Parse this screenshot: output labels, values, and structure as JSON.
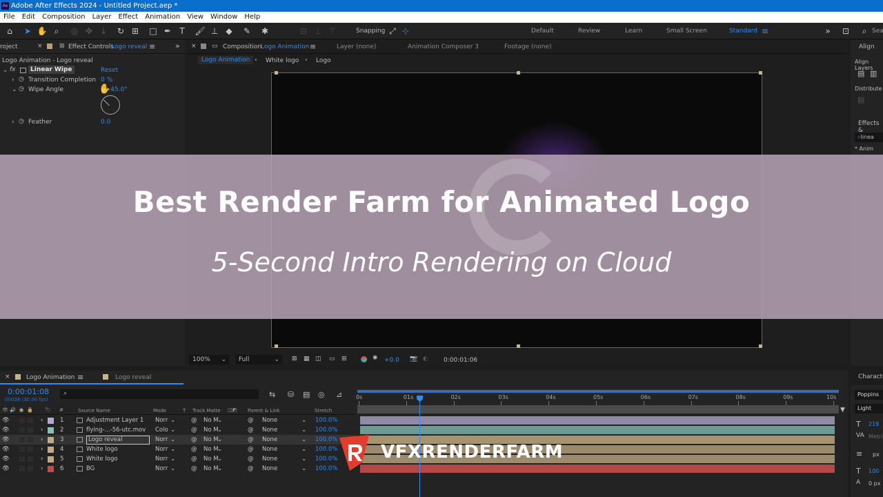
{
  "titlebar": {
    "title": "Adobe After Effects 2024 - Untitled Project.aep *"
  },
  "menu": [
    "File",
    "Edit",
    "Composition",
    "Layer",
    "Effect",
    "Animation",
    "View",
    "Window",
    "Help"
  ],
  "toolbar": {
    "snapping": "Snapping",
    "workspaces": [
      "Default",
      "Review",
      "Learn",
      "Small Screen",
      "Standard"
    ],
    "search": "Sea"
  },
  "left_panel": {
    "project_tab": "roject",
    "effect_controls_tab": "Effect Controls",
    "effect_controls_layer": "Logo reveal",
    "breadcrumb": "Logo Animation - Logo reveal",
    "effect_name": "Linear Wipe",
    "reset": "Reset",
    "props": [
      {
        "name": "Transition Completion",
        "value": "0 %"
      },
      {
        "name": "Wipe Angle",
        "value": "0x-45.0°"
      },
      {
        "name": "Feather",
        "value": "0.0"
      }
    ]
  },
  "comp_panel": {
    "tab_label": "Composition",
    "tab_comp": "Logo Animation",
    "layer_tab": "Layer  (none)",
    "composer_tab": "Animation Composer 3",
    "footage_tab": "Footage  (none)",
    "flow": [
      "Logo Animation",
      "White logo",
      "Logo"
    ],
    "zoom": "100%",
    "resolution": "Full",
    "exposure": "+0.0",
    "timecode": "0:00:01:06"
  },
  "right_panel": {
    "align": "Align",
    "align_layers": "Align Layers",
    "distribute": "Distribute",
    "effects": "Effects &",
    "effects_search": "linea",
    "anim": "* Anim",
    "character": "Characte",
    "font": "Poppins",
    "style": "Light",
    "size": "219",
    "metrics": "Metri",
    "px": "px",
    "scale": "100",
    "px2": "0 px"
  },
  "timeline": {
    "tab1": "Logo Animation",
    "tab2": "Logo reveal",
    "timecode": "0:00:01:08",
    "frames": "00038 (30.00 fps)",
    "headers": {
      "source": "Source Name",
      "mode": "Mode",
      "t": "T",
      "matte": "Track Matte",
      "parent": "Parent & Link",
      "stretch": "Stretch"
    },
    "ruler": [
      "0s",
      "01s",
      "02s",
      "03s",
      "04s",
      "05s",
      "06s",
      "07s",
      "08s",
      "09s",
      "10s"
    ],
    "playhead_fraction": 0.128,
    "layers": [
      {
        "num": "1",
        "name": "Adjustment Layer 1",
        "mode": "Norr",
        "matte": "No M",
        "parent": "None",
        "stretch": "100.0%",
        "color": "#b7a5d6",
        "track": "#8e8aa6"
      },
      {
        "num": "2",
        "name": "flying-...-56-utc.mov",
        "mode": "Colo",
        "matte": "No M",
        "parent": "None",
        "stretch": "100.0%",
        "color": "#7fc4b8",
        "track": "#6e9a94"
      },
      {
        "num": "3",
        "name": "Logo reveal",
        "mode": "Norr",
        "matte": "No M",
        "parent": "None",
        "stretch": "100.0%",
        "color": "#c8a97d",
        "track": "#a89370"
      },
      {
        "num": "4",
        "name": "White logo",
        "mode": "Norr",
        "matte": "No M",
        "parent": "None",
        "stretch": "100.0%",
        "color": "#c8a97d",
        "track": "#9c8a6c"
      },
      {
        "num": "5",
        "name": "White logo",
        "mode": "Norr",
        "matte": "No M",
        "parent": "None",
        "stretch": "100.0%",
        "color": "#c8a97d",
        "track": "#9c8a6c"
      },
      {
        "num": "6",
        "name": "BG",
        "mode": "Norr",
        "matte": "No M",
        "parent": "None",
        "stretch": "100.0%",
        "color": "#d04646",
        "track": "#b54848"
      }
    ]
  },
  "banner": {
    "title": "Best Render Farm for Animated Logo",
    "subtitle": "5-Second Intro Rendering on Cloud"
  },
  "watermark": {
    "text": "VFXRENDERFARM"
  },
  "colors": {
    "accent": "#2f8cf0",
    "titlebar": "#0a6fcc",
    "overlay": "#b4a0b2",
    "logo_red": "#e23d2c"
  }
}
